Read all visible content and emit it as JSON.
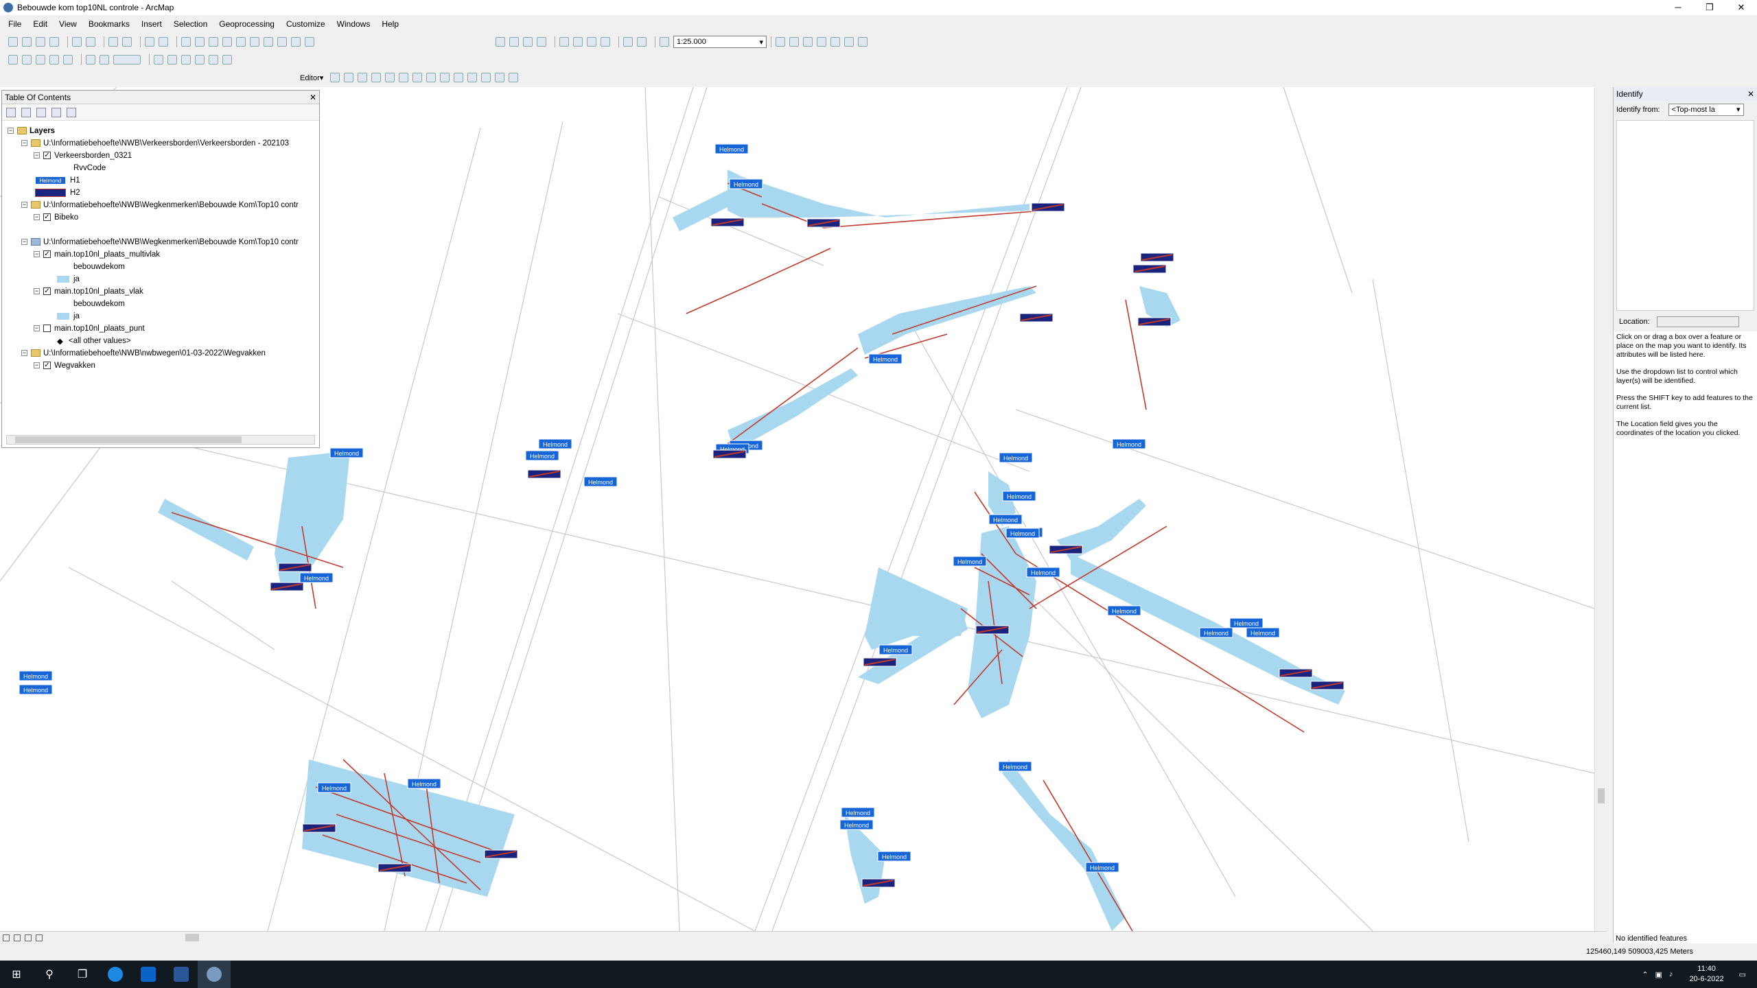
{
  "window": {
    "title": "Bebouwde kom top10NL controle - ArcMap",
    "minimize": "─",
    "restore": "❐",
    "close": "✕"
  },
  "menu": [
    "File",
    "Edit",
    "View",
    "Bookmarks",
    "Insert",
    "Selection",
    "Geoprocessing",
    "Customize",
    "Windows",
    "Help"
  ],
  "toolbar": {
    "scale": "1:25.000",
    "editor_label": "Editor▾"
  },
  "toc": {
    "title": "Table Of Contents",
    "items": [
      {
        "label": "Layers"
      },
      {
        "label": "U:\\Informatiebehoefte\\NWB\\Verkeersborden\\Verkeersborden - 202103"
      },
      {
        "label": "Verkeersborden_0321"
      },
      {
        "label": "RvvCode"
      },
      {
        "label": "H1"
      },
      {
        "label": "H2"
      },
      {
        "label": "U:\\Informatiebehoefte\\NWB\\Wegkenmerken\\Bebouwde Kom\\Top10 contr"
      },
      {
        "label": "Bibeko"
      },
      {
        "label": "U:\\Informatiebehoefte\\NWB\\Wegkenmerken\\Bebouwde Kom\\Top10 contr"
      },
      {
        "label": "main.top10nl_plaats_multivlak"
      },
      {
        "label": "bebouwdekom"
      },
      {
        "label": "ja"
      },
      {
        "label": "main.top10nl_plaats_vlak"
      },
      {
        "label": "bebouwdekom"
      },
      {
        "label": "ja"
      },
      {
        "label": "main.top10nl_plaats_punt"
      },
      {
        "label": "<all other values>"
      },
      {
        "label": "U:\\Informatiebehoefte\\NWB\\nwbwegen\\01-03-2022\\Wegvakken"
      },
      {
        "label": "Wegvakken"
      }
    ]
  },
  "map": {
    "sign_label": "Helmond",
    "fill_color": "#a8d8f0",
    "road_color": "#c0392b",
    "sign_color": "#1565d8"
  },
  "identify": {
    "title": "Identify",
    "from_label": "Identify from:",
    "from_value": "<Top-most la",
    "location_label": "Location:",
    "help": [
      "Click on or drag a box over a feature or place on the map you want to identify. Its attributes will be listed here.",
      "Use the dropdown list to control which layer(s) will be identified.",
      "Press the SHIFT key to add features to the current list.",
      "The Location field gives you the coordinates of the location you clicked."
    ],
    "status": "No identified features"
  },
  "status": {
    "coords": "125460,149  509003,425 Meters"
  },
  "taskbar": {
    "time": "11:40",
    "date": "20-6-2022"
  }
}
